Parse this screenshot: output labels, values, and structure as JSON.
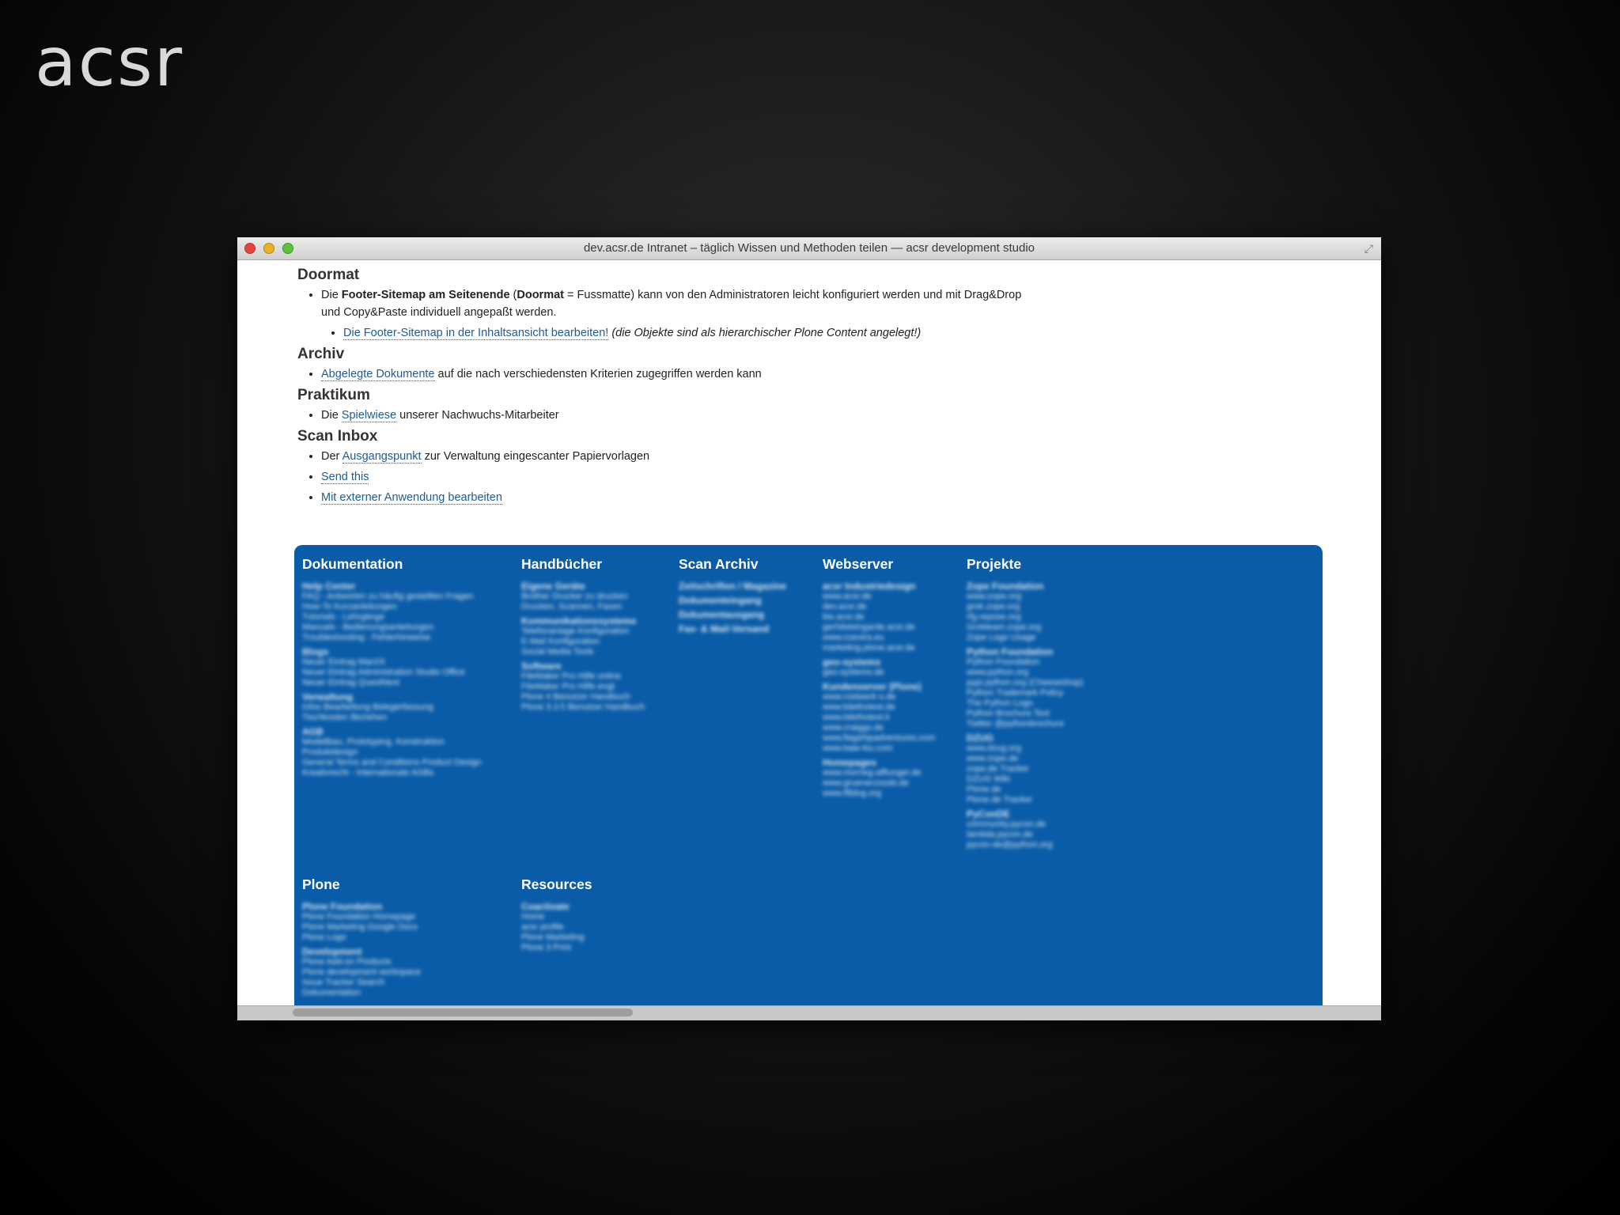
{
  "logo": "acsr",
  "window": {
    "title": "dev.acsr.de Intranet – täglich Wissen und Methoden teilen — acsr development studio"
  },
  "sections": {
    "doormat": {
      "heading": "Doormat",
      "li1_a": "Die ",
      "li1_b": "Footer-Sitemap am Seitenende",
      "li1_c": " (",
      "li1_d": "Doormat",
      "li1_e": " = Fussmatte) kann von den Administratoren leicht konfiguriert werden und mit Drag&Drop und Copy&Paste individuell angepaßt werden.",
      "sub_link": "Die Footer-Sitemap in der Inhaltsansicht bearbeiten!",
      "sub_note": " (die Objekte sind als hierarchischer Plone Content angelegt!)"
    },
    "archiv": {
      "heading": "Archiv",
      "link": "Abgelegte Dokumente",
      "rest": " auf die nach verschiedensten Kriterien zugegriffen werden kann"
    },
    "praktikum": {
      "heading": "Praktikum",
      "pre": "Die ",
      "link": "Spielwiese",
      "rest": " unserer Nachwuchs-Mitarbeiter"
    },
    "scan_inbox": {
      "heading": "Scan Inbox",
      "pre": "Der ",
      "link": "Ausgangspunkt",
      "rest": " zur Verwaltung eingescanter Papiervorlagen",
      "send": "Send this",
      "edit": "Mit externer Anwendung bearbeiten"
    }
  },
  "footer": {
    "columns": [
      {
        "heading": "Dokumentation",
        "groups": [
          {
            "title": "Help Center",
            "items": [
              "FAQ - Antworten zu häufig gestellten Fragen",
              "How-To Kurzanleitungen",
              "Tutorials - Lehrgänge",
              "Manuals - Bedienungsanleitungen",
              "Troubleshooting - Fehlerhinweise"
            ]
          },
          {
            "title": "Blogs",
            "items": [
              "Neuer Eintrag Mac0X",
              "Neuer Eintrag Administration Studio Office",
              "Neuer Eintrag QuestNext"
            ]
          },
          {
            "title": "Verwaltung",
            "items": [
              "Infos Bearbeitung Belegerfassung",
              "Tischkosten Beziehen"
            ]
          },
          {
            "title": "AGB",
            "items": [
              "Modellbau, Prototyping, Konstruktion",
              "Produktdesign",
              "General Terms and Conditions Product Design",
              "Kreativrecht - Internationale AGBs"
            ]
          }
        ]
      },
      {
        "heading": "Handbücher",
        "groups": [
          {
            "title": "Eigene Geräte",
            "items": [
              "Brother Drucker zu drucken",
              "Drucken, Scannen, Faxen"
            ]
          },
          {
            "title": "Kommunikationssysteme",
            "items": [
              "Telefonanlage Konfiguration",
              "E-Mail Konfiguration",
              "Social Media Tools"
            ]
          },
          {
            "title": "Software",
            "items": [
              "FileMaker Pro Hilfe online",
              "FileMaker Pro Hilfe engl.",
              "Plone 4 Benutzer Handbuch",
              "Plone 3.3.5 Benutzer Handbuch"
            ]
          }
        ]
      },
      {
        "heading": "Scan Archiv",
        "groups": [
          {
            "title": "Zeitschriften / Magazine",
            "items": []
          },
          {
            "title": "Dokumenteingang",
            "items": []
          },
          {
            "title": "Dokumentausgang",
            "items": []
          },
          {
            "title": "Fax- & Mail-Versand",
            "items": []
          }
        ]
      },
      {
        "heading": "Webserver",
        "groups": [
          {
            "title": "acsr Industriedesign",
            "items": [
              "www.acsr.de",
              "dev.acsr.de",
              "bis.acsr.de",
              "gerhilsteingarde.acsr.de",
              "www.coextra.eu",
              "marketing.plone.acsr.de"
            ]
          },
          {
            "title": "geo-systems",
            "items": [
              "geo-systems.de"
            ]
          },
          {
            "title": "Kundenserver (Plone)",
            "items": [
              "www.rostwerk-s.de",
              "www.bilethotest.de",
              "www.bilethotest.li",
              "www.craiggs.de",
              "www.flagshipadventures.com",
              "www.baie-kiu.com"
            ]
          },
          {
            "title": "Homepages",
            "items": [
              "www.morrieg-afflunger.de",
              "www.gruenerzoosb.de",
              "www.fllblog.org"
            ]
          }
        ]
      },
      {
        "heading": "Projekte",
        "groups": [
          {
            "title": "Zope Foundation",
            "items": [
              "www.zope.org",
              "grok.zope.org",
              "rfg.repose.org",
              "Grokteam.zope.org",
              "Zope Logo Usage"
            ]
          },
          {
            "title": "Python Foundation",
            "items": [
              "Python Foundation",
              "www.python.org",
              "pypi.python.org (Cheeseshop)",
              "Python Trademark Policy",
              "The Python Logo",
              "Python Brochure Text",
              "Twitter @pythonbrochure"
            ]
          },
          {
            "title": "DZUG",
            "items": [
              "www.dzug.org",
              "www.zope.de",
              "zope.de Tracker",
              "DZUG Wiki",
              "Plone.de",
              "Plone.de Tracker"
            ]
          },
          {
            "title": "PyConDE",
            "items": [
              "community.pycon.de",
              "lambda.pycon.de",
              "pycon-de@python.org"
            ]
          }
        ]
      },
      {
        "heading": "Plone",
        "groups": [
          {
            "title": "Plone Foundation",
            "items": [
              "Plone Foundation Homepage",
              "Plone Marketing Google Docs",
              "Plone Logo"
            ]
          },
          {
            "title": "Development",
            "items": [
              "Plone Add-on Products",
              "Plone development workspace",
              "Issue Tracker Search",
              "Dokumentation"
            ]
          }
        ]
      },
      {
        "heading": "Resources",
        "groups": [
          {
            "title": "Coactivate",
            "items": [
              "Home",
              "acsr profile",
              "Plone Marketing",
              "Plone 3 Print"
            ]
          }
        ]
      }
    ]
  }
}
